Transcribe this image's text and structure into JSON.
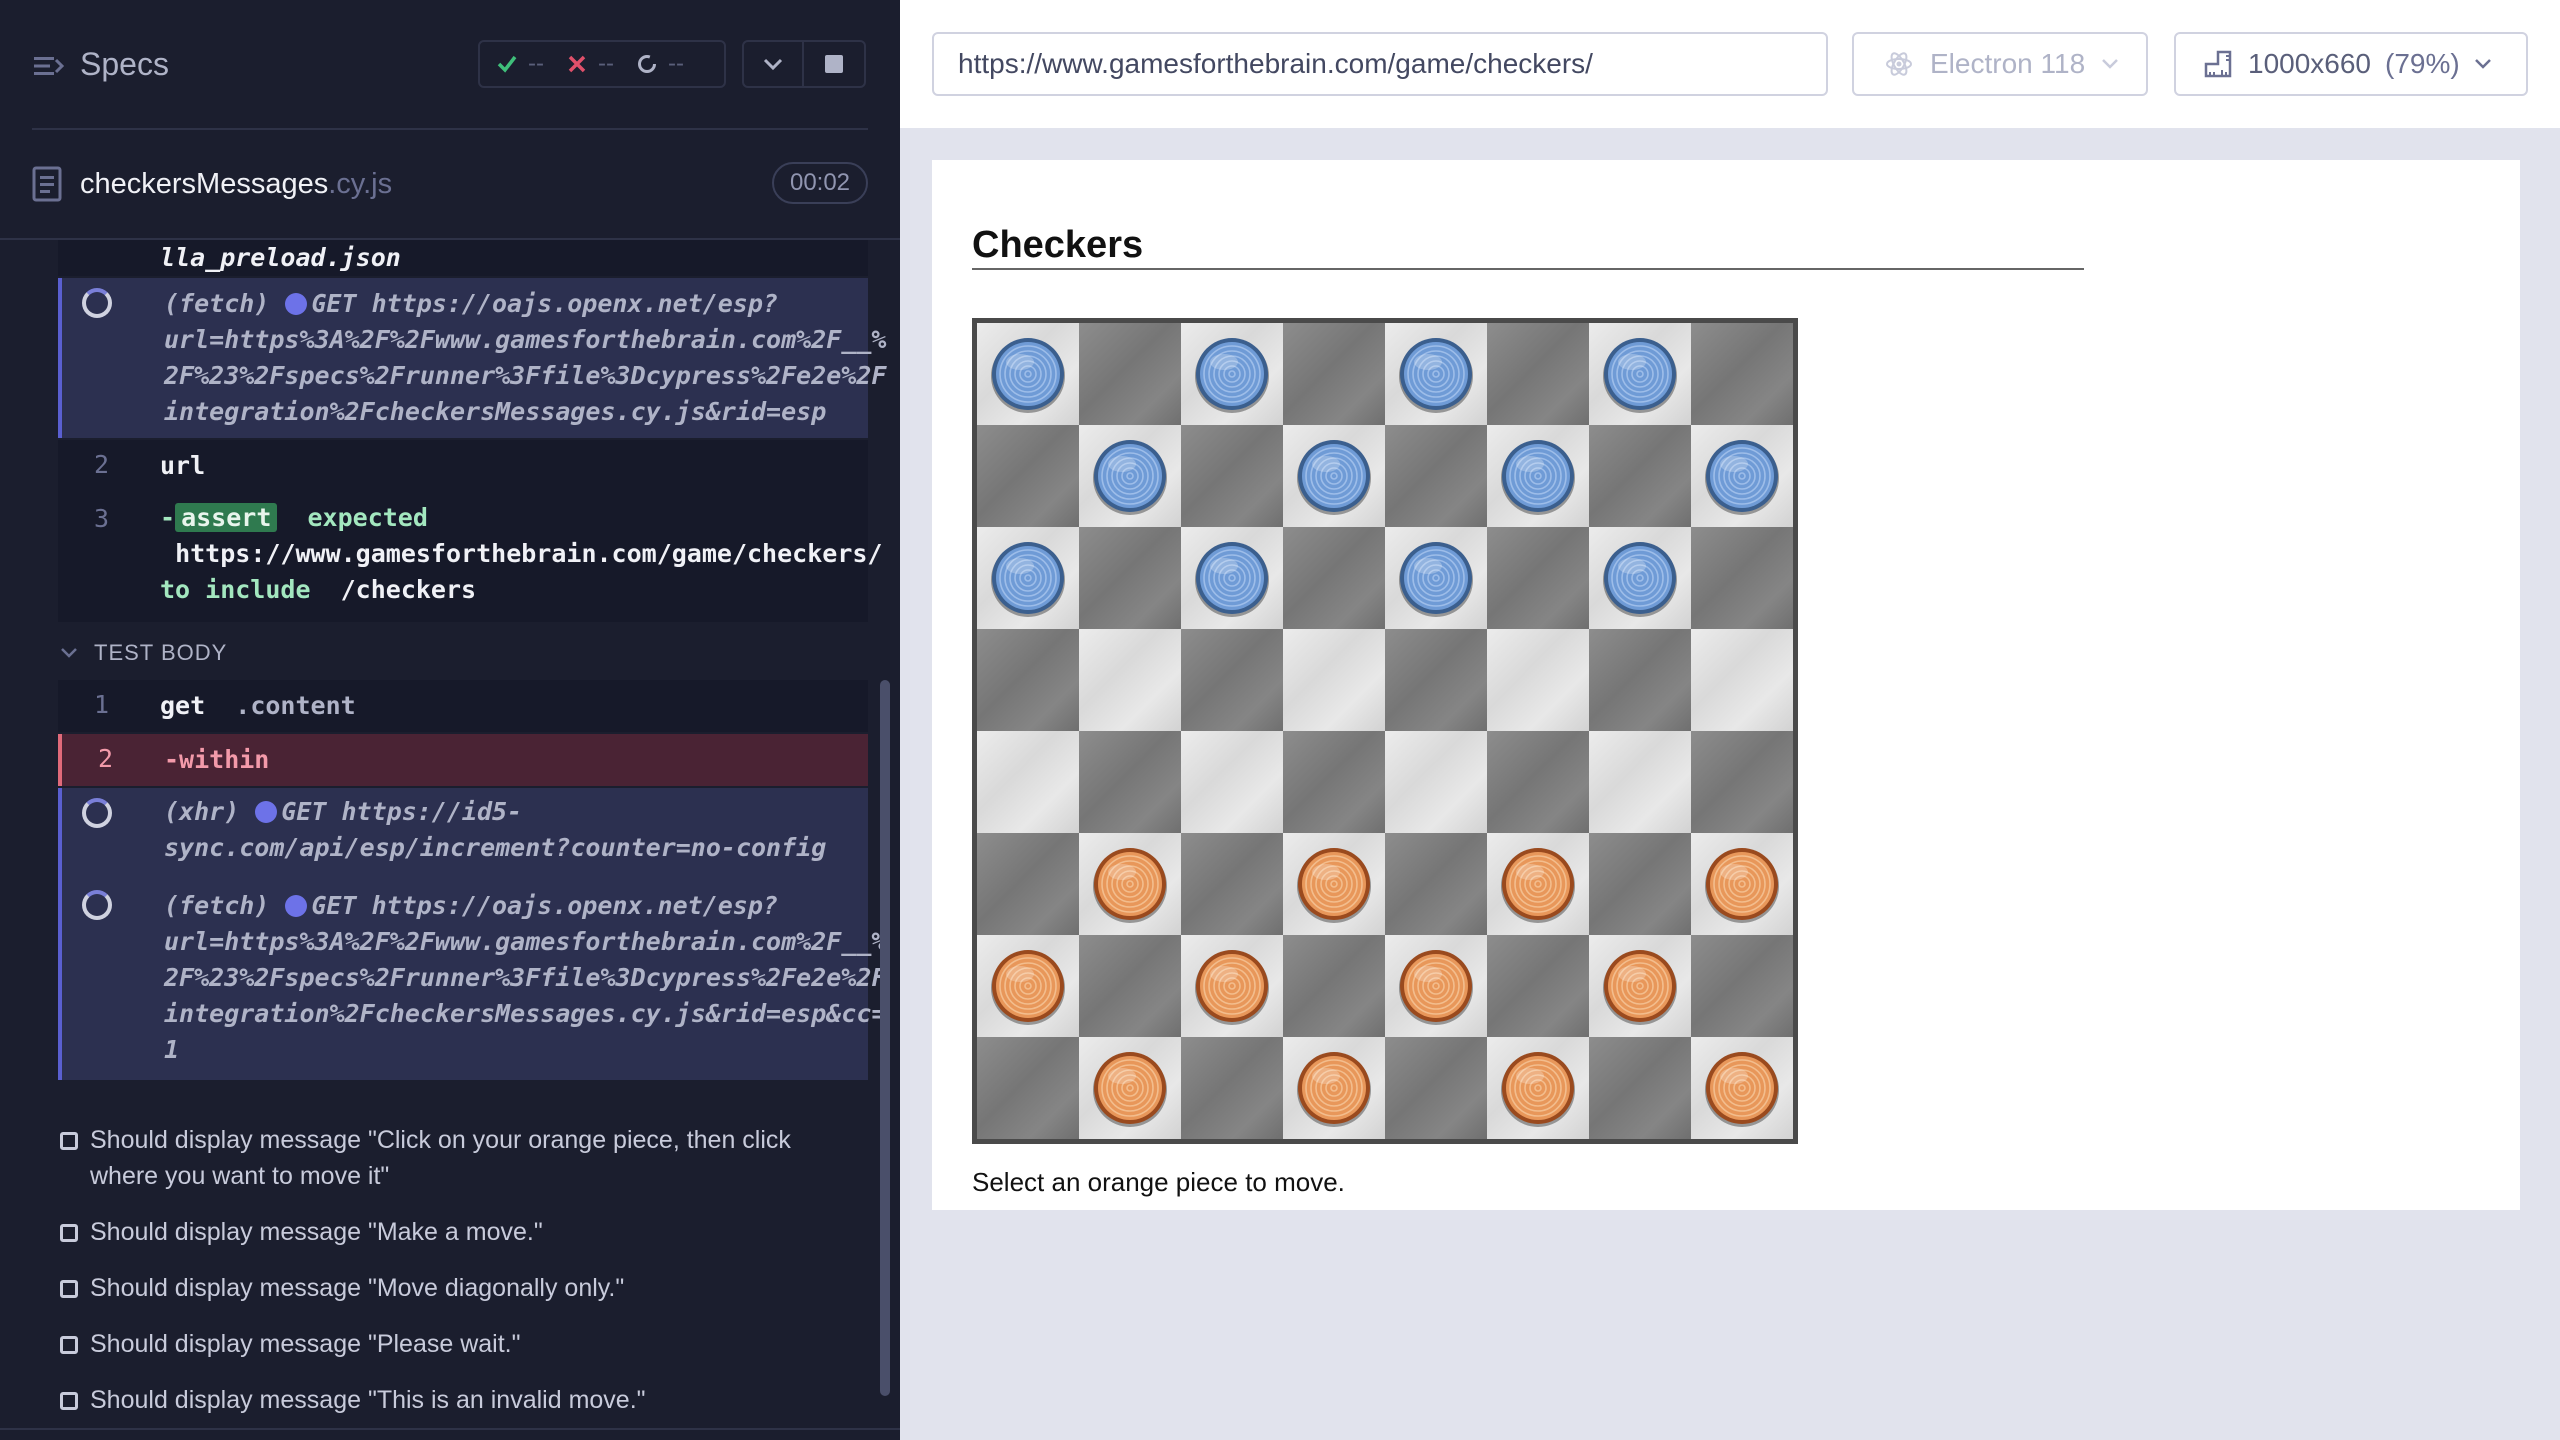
{
  "runner": {
    "specs_label": "Specs",
    "stats": {
      "passed": "--",
      "failed": "--",
      "pending": "--"
    },
    "file": {
      "name": "checkersMessages",
      "ext": ".cy.js",
      "duration": "00:02"
    },
    "log": {
      "truncated_line": "lla_preload.json",
      "fetch1": {
        "type": "(fetch)",
        "method": "GET",
        "url_lines": [
          "https://oajs.openx.net/esp?",
          "url=https%3A%2F%2Fwww.gamesforthebrain.com%2F__%",
          "2F%23%2Fspecs%2Frunner%3Ffile%3Dcypress%2Fe2e%2F",
          "integration%2FcheckersMessages.cy.js&rid=esp"
        ]
      },
      "cmd2": {
        "num": "2",
        "name": "url"
      },
      "cmd3": {
        "num": "3",
        "prefix": "-",
        "badge": "assert",
        "expected": "expected",
        "value": "https://www.gamesforthebrain.com/game/checkers/",
        "to_include": "to include",
        "include_value": "/checkers"
      },
      "test_body_label": "TEST BODY",
      "tb1": {
        "num": "1",
        "name": "get",
        "arg": ".content"
      },
      "tb2": {
        "num": "2",
        "name": "-within"
      },
      "xhr": {
        "type": "(xhr)",
        "method": "GET",
        "url_lines": [
          "https://id5-",
          "sync.com/api/esp/increment?counter=no-config"
        ]
      },
      "fetch2": {
        "type": "(fetch)",
        "method": "GET",
        "url_lines": [
          "https://oajs.openx.net/esp?",
          "url=https%3A%2F%2Fwww.gamesforthebrain.com%2F__%",
          "2F%23%2Fspecs%2Frunner%3Ffile%3Dcypress%2Fe2e%2F",
          "integration%2FcheckersMessages.cy.js&rid=esp&cc=",
          "1"
        ]
      }
    },
    "tests": [
      "Should display message \"Click on your orange piece, then click where you want to move it\"",
      "Should display message \"Make a move.\"",
      "Should display message \"Move diagonally only.\"",
      "Should display message \"Please wait.\"",
      "Should display message \"This is an invalid move.\""
    ]
  },
  "browser": {
    "url": "https://www.gamesforthebrain.com/game/checkers/",
    "browser_label": "Electron 118",
    "viewport_label": "1000x660",
    "viewport_pct": "(79%)"
  },
  "game": {
    "title": "Checkers",
    "status": "Select an orange piece to move.",
    "board": [
      "B.B.B.B.",
      ".B.B.B.B",
      "B.B.B.B.",
      "........",
      "........",
      ".O.O.O.O",
      "O.O.O.O.",
      ".O.O.O.O"
    ],
    "colors": {
      "blue_piece": "#6f9bd6",
      "orange_piece": "#e8975a"
    }
  }
}
